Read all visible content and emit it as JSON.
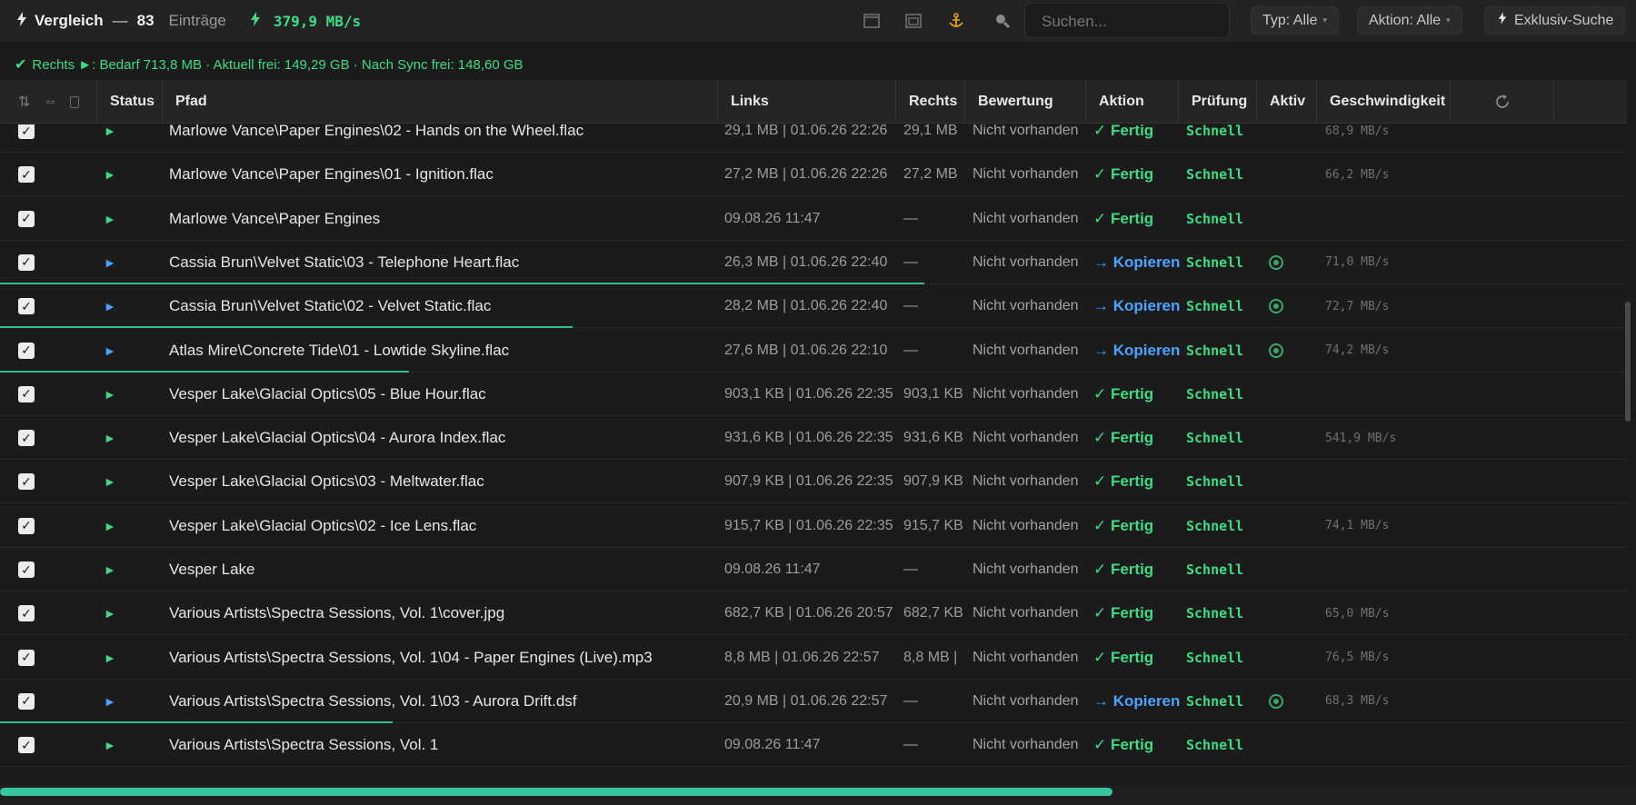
{
  "toolbar": {
    "title": "Vergleich",
    "dash": "—",
    "count": "83",
    "entries_label": "Einträge",
    "speed": "379,9 MB/s",
    "search_placeholder": "Suchen...",
    "type_filter": "Typ: Alle",
    "action_filter": "Aktion: Alle",
    "exclusive_search": "Exklusiv-Suche"
  },
  "status": {
    "text": "Rechts ►: Bedarf 713,8 MB · Aktuell frei: 149,29 GB · Nach Sync frei: 148,60 GB"
  },
  "columns": {
    "status": "Status",
    "pfad": "Pfad",
    "links": "Links",
    "rechts": "Rechts",
    "bewertung": "Bewertung",
    "aktion": "Aktion",
    "pruefung": "Prüfung",
    "aktiv": "Aktiv",
    "geschwindigkeit": "Geschwindigkeit"
  },
  "colors": {
    "accent_green": "#3ddc84",
    "copy_blue": "#4aa3ff",
    "progress": "#2fbf95"
  },
  "rows": [
    {
      "path": "Marlowe Vance\\Paper Engines\\02 - Hands on the Wheel.flac",
      "links": "29,1 MB | 01.06.26 22:26",
      "rechts": "29,1 MB",
      "bewertung": "Nicht vorhanden",
      "aktion": "✓ Fertig",
      "kind": "done",
      "pruefung": "Schnell",
      "active": false,
      "speed": "68,9 MB/s",
      "progress": 0
    },
    {
      "path": "Marlowe Vance\\Paper Engines\\01 - Ignition.flac",
      "links": "27,2 MB | 01.06.26 22:26",
      "rechts": "27,2 MB",
      "bewertung": "Nicht vorhanden",
      "aktion": "✓ Fertig",
      "kind": "done",
      "pruefung": "Schnell",
      "active": false,
      "speed": "66,2 MB/s",
      "progress": 0
    },
    {
      "path": "Marlowe Vance\\Paper Engines",
      "links": "09.08.26 11:47",
      "rechts": "—",
      "bewertung": "Nicht vorhanden",
      "aktion": "✓ Fertig",
      "kind": "done",
      "pruefung": "Schnell",
      "active": false,
      "speed": "",
      "progress": 0
    },
    {
      "path": "Cassia Brun\\Velvet Static\\03 - Telephone Heart.flac",
      "links": "26,3 MB | 01.06.26 22:40",
      "rechts": "—",
      "bewertung": "Nicht vorhanden",
      "aktion": "→ Kopieren",
      "kind": "copy",
      "pruefung": "Schnell",
      "active": true,
      "speed": "71,0 MB/s",
      "progress": 0.565
    },
    {
      "path": "Cassia Brun\\Velvet Static\\02 - Velvet Static.flac",
      "links": "28,2 MB | 01.06.26 22:40",
      "rechts": "—",
      "bewertung": "Nicht vorhanden",
      "aktion": "→ Kopieren",
      "kind": "copy",
      "pruefung": "Schnell",
      "active": true,
      "speed": "72,7 MB/s",
      "progress": 0.35
    },
    {
      "path": "Atlas Mire\\Concrete Tide\\01 - Lowtide Skyline.flac",
      "links": "27,6 MB | 01.06.26 22:10",
      "rechts": "—",
      "bewertung": "Nicht vorhanden",
      "aktion": "→ Kopieren",
      "kind": "copy",
      "pruefung": "Schnell",
      "active": true,
      "speed": "74,2 MB/s",
      "progress": 0.25
    },
    {
      "path": "Vesper Lake\\Glacial Optics\\05 - Blue Hour.flac",
      "links": "903,1 KB | 01.06.26 22:35",
      "rechts": "903,1 KB",
      "bewertung": "Nicht vorhanden",
      "aktion": "✓ Fertig",
      "kind": "done",
      "pruefung": "Schnell",
      "active": false,
      "speed": "",
      "progress": 0
    },
    {
      "path": "Vesper Lake\\Glacial Optics\\04 - Aurora Index.flac",
      "links": "931,6 KB | 01.06.26 22:35",
      "rechts": "931,6 KB",
      "bewertung": "Nicht vorhanden",
      "aktion": "✓ Fertig",
      "kind": "done",
      "pruefung": "Schnell",
      "active": false,
      "speed": "541,9 MB/s",
      "progress": 0
    },
    {
      "path": "Vesper Lake\\Glacial Optics\\03 - Meltwater.flac",
      "links": "907,9 KB | 01.06.26 22:35",
      "rechts": "907,9 KB",
      "bewertung": "Nicht vorhanden",
      "aktion": "✓ Fertig",
      "kind": "done",
      "pruefung": "Schnell",
      "active": false,
      "speed": "",
      "progress": 0
    },
    {
      "path": "Vesper Lake\\Glacial Optics\\02 - Ice Lens.flac",
      "links": "915,7 KB | 01.06.26 22:35",
      "rechts": "915,7 KB",
      "bewertung": "Nicht vorhanden",
      "aktion": "✓ Fertig",
      "kind": "done",
      "pruefung": "Schnell",
      "active": false,
      "speed": "74,1 MB/s",
      "progress": 0
    },
    {
      "path": "Vesper Lake",
      "links": "09.08.26 11:47",
      "rechts": "—",
      "bewertung": "Nicht vorhanden",
      "aktion": "✓ Fertig",
      "kind": "done",
      "pruefung": "Schnell",
      "active": false,
      "speed": "",
      "progress": 0
    },
    {
      "path": "Various Artists\\Spectra Sessions, Vol. 1\\cover.jpg",
      "links": "682,7 KB | 01.06.26 20:57",
      "rechts": "682,7 KB",
      "bewertung": "Nicht vorhanden",
      "aktion": "✓ Fertig",
      "kind": "done",
      "pruefung": "Schnell",
      "active": false,
      "speed": "65,0 MB/s",
      "progress": 0
    },
    {
      "path": "Various Artists\\Spectra Sessions, Vol. 1\\04 - Paper Engines (Live).mp3",
      "links": "8,8 MB | 01.06.26 22:57",
      "rechts": "8,8 MB |",
      "bewertung": "Nicht vorhanden",
      "aktion": "✓ Fertig",
      "kind": "done",
      "pruefung": "Schnell",
      "active": false,
      "speed": "76,5 MB/s",
      "progress": 0
    },
    {
      "path": "Various Artists\\Spectra Sessions, Vol. 1\\03 - Aurora Drift.dsf",
      "links": "20,9 MB | 01.06.26 22:57",
      "rechts": "—",
      "bewertung": "Nicht vorhanden",
      "aktion": "→ Kopieren",
      "kind": "copy",
      "pruefung": "Schnell",
      "active": true,
      "speed": "68,3 MB/s",
      "progress": 0.24
    },
    {
      "path": "Various Artists\\Spectra Sessions, Vol. 1",
      "links": "09.08.26 11:47",
      "rechts": "—",
      "bewertung": "Nicht vorhanden",
      "aktion": "✓ Fertig",
      "kind": "done",
      "pruefung": "Schnell",
      "active": false,
      "speed": "",
      "progress": 0
    }
  ],
  "horizontal_scroll": 0.68
}
